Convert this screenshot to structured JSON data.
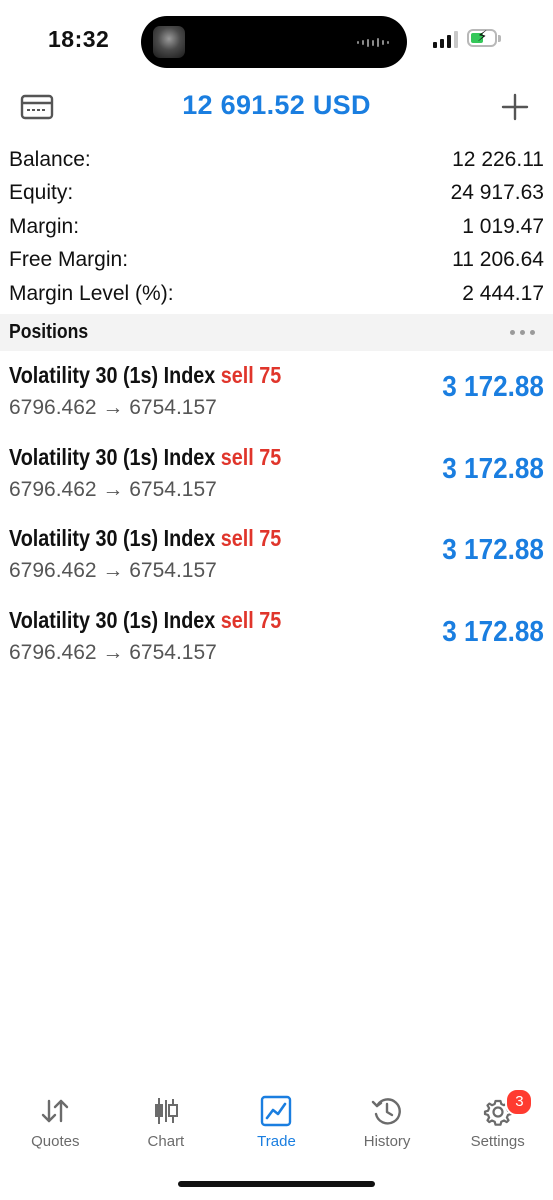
{
  "status_bar": {
    "time": "18:32"
  },
  "header": {
    "title": "12 691.52 USD",
    "left_icon": "card-icon",
    "right_icon": "plus-icon"
  },
  "summary": [
    {
      "label": "Balance:",
      "value": "12 226.11"
    },
    {
      "label": "Equity:",
      "value": "24 917.63"
    },
    {
      "label": "Margin:",
      "value": "1 019.47"
    },
    {
      "label": "Free Margin:",
      "value": "11 206.64"
    },
    {
      "label": "Margin Level (%):",
      "value": "2 444.17"
    }
  ],
  "positions_section": {
    "title": "Positions"
  },
  "positions": [
    {
      "symbol": "Volatility 30 (1s) Index",
      "type": "sell 75",
      "prices": "6796.462 → 6754.157",
      "profit": "3 172.88"
    },
    {
      "symbol": "Volatility 30 (1s) Index",
      "type": "sell 75",
      "prices": "6796.462 → 6754.157",
      "profit": "3 172.88"
    },
    {
      "symbol": "Volatility 30 (1s) Index",
      "type": "sell 75",
      "prices": "6796.462 → 6754.157",
      "profit": "3 172.88"
    },
    {
      "symbol": "Volatility 30 (1s) Index",
      "type": "sell 75",
      "prices": "6796.462 → 6754.157",
      "profit": "3 172.88"
    }
  ],
  "tabs": [
    {
      "label": "Quotes",
      "icon": "quotes-arrows-icon"
    },
    {
      "label": "Chart",
      "icon": "candlestick-icon"
    },
    {
      "label": "Trade",
      "icon": "trade-chart-icon",
      "active": true
    },
    {
      "label": "History",
      "icon": "history-clock-icon"
    },
    {
      "label": "Settings",
      "icon": "gear-icon",
      "badge": "3"
    }
  ],
  "colors": {
    "accent": "#1a7ee0",
    "sell": "#e0352b",
    "badge": "#ff3b30"
  }
}
